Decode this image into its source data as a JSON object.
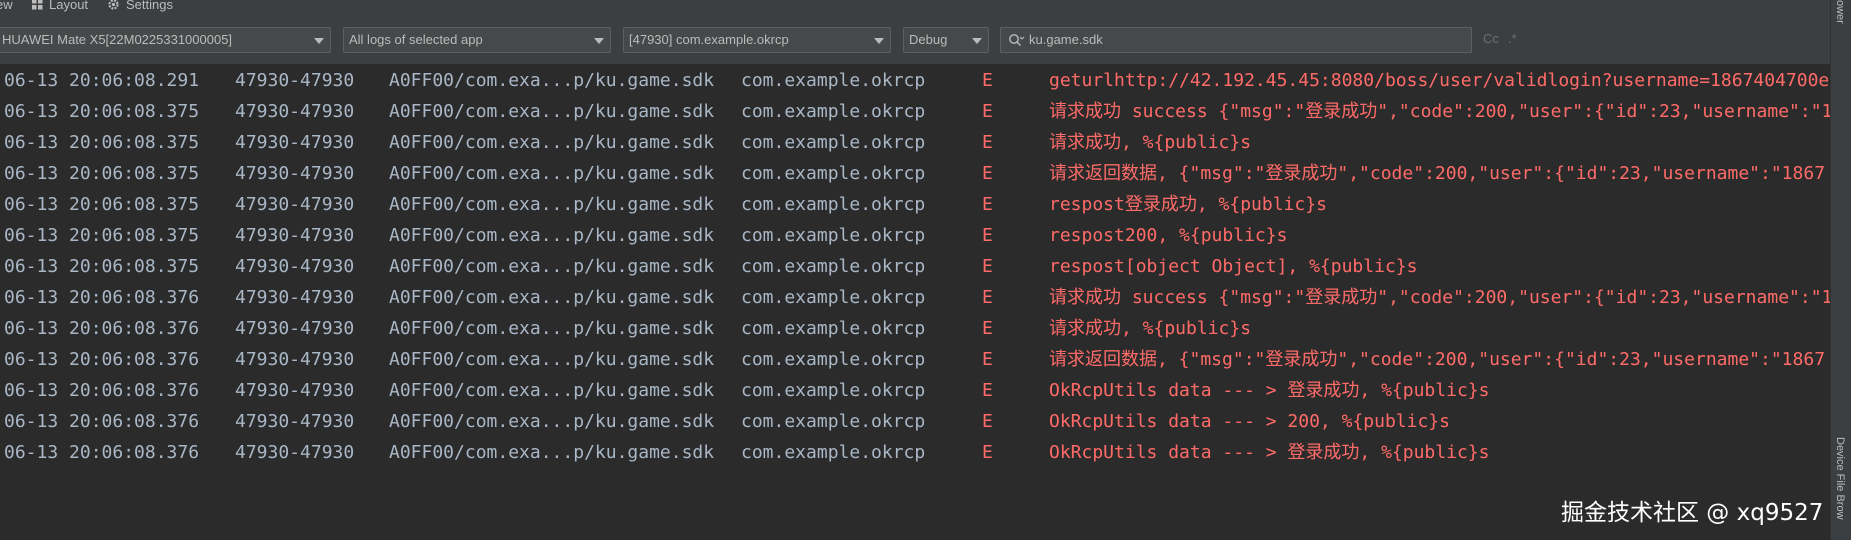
{
  "menubar": {
    "view_label": "ew",
    "layout_label": "Layout",
    "settings_label": "Settings"
  },
  "toolbar": {
    "device": "HUAWEI Mate X5[22M0225331000005]",
    "log_scope": "All logs of selected app",
    "process": "[47930] com.example.okrcp",
    "level": "Debug",
    "search_value": "ku.game.sdk",
    "match_case_label": "Cc",
    "regex_label": ".*"
  },
  "right_panel": {
    "top_label": "ower",
    "bottom_label": "Device File Brow"
  },
  "log_rows": [
    {
      "time": "06-13 20:06:08.291",
      "pid": "47930-47930",
      "tag": "A0FF00/com.exa...p/ku.game.sdk",
      "package": "com.example.okrcp",
      "level": "E",
      "message": "geturlhttp://42.192.45.45:8080/boss/user/validlogin?username=1867404700e"
    },
    {
      "time": "06-13 20:06:08.375",
      "pid": "47930-47930",
      "tag": "A0FF00/com.exa...p/ku.game.sdk",
      "package": "com.example.okrcp",
      "level": "E",
      "message": "请求成功 success {\"msg\":\"登录成功\",\"code\":200,\"user\":{\"id\":23,\"username\":\"1"
    },
    {
      "time": "06-13 20:06:08.375",
      "pid": "47930-47930",
      "tag": "A0FF00/com.exa...p/ku.game.sdk",
      "package": "com.example.okrcp",
      "level": "E",
      "message": "请求成功, %{public}s"
    },
    {
      "time": "06-13 20:06:08.375",
      "pid": "47930-47930",
      "tag": "A0FF00/com.exa...p/ku.game.sdk",
      "package": "com.example.okrcp",
      "level": "E",
      "message": "请求返回数据, {\"msg\":\"登录成功\",\"code\":200,\"user\":{\"id\":23,\"username\":\"1867"
    },
    {
      "time": "06-13 20:06:08.375",
      "pid": "47930-47930",
      "tag": "A0FF00/com.exa...p/ku.game.sdk",
      "package": "com.example.okrcp",
      "level": "E",
      "message": "respost登录成功, %{public}s"
    },
    {
      "time": "06-13 20:06:08.375",
      "pid": "47930-47930",
      "tag": "A0FF00/com.exa...p/ku.game.sdk",
      "package": "com.example.okrcp",
      "level": "E",
      "message": "respost200, %{public}s"
    },
    {
      "time": "06-13 20:06:08.375",
      "pid": "47930-47930",
      "tag": "A0FF00/com.exa...p/ku.game.sdk",
      "package": "com.example.okrcp",
      "level": "E",
      "message": "respost[object Object], %{public}s"
    },
    {
      "time": "06-13 20:06:08.376",
      "pid": "47930-47930",
      "tag": "A0FF00/com.exa...p/ku.game.sdk",
      "package": "com.example.okrcp",
      "level": "E",
      "message": "请求成功 success {\"msg\":\"登录成功\",\"code\":200,\"user\":{\"id\":23,\"username\":\"1"
    },
    {
      "time": "06-13 20:06:08.376",
      "pid": "47930-47930",
      "tag": "A0FF00/com.exa...p/ku.game.sdk",
      "package": "com.example.okrcp",
      "level": "E",
      "message": "请求成功, %{public}s"
    },
    {
      "time": "06-13 20:06:08.376",
      "pid": "47930-47930",
      "tag": "A0FF00/com.exa...p/ku.game.sdk",
      "package": "com.example.okrcp",
      "level": "E",
      "message": "请求返回数据, {\"msg\":\"登录成功\",\"code\":200,\"user\":{\"id\":23,\"username\":\"1867"
    },
    {
      "time": "06-13 20:06:08.376",
      "pid": "47930-47930",
      "tag": "A0FF00/com.exa...p/ku.game.sdk",
      "package": "com.example.okrcp",
      "level": "E",
      "message": "OkRcpUtils data --- > 登录成功, %{public}s"
    },
    {
      "time": "06-13 20:06:08.376",
      "pid": "47930-47930",
      "tag": "A0FF00/com.exa...p/ku.game.sdk",
      "package": "com.example.okrcp",
      "level": "E",
      "message": "OkRcpUtils data --- > 200, %{public}s"
    },
    {
      "time": "06-13 20:06:08.376",
      "pid": "47930-47930",
      "tag": "A0FF00/com.exa...p/ku.game.sdk",
      "package": "com.example.okrcp",
      "level": "E",
      "message": "OkRcpUtils data --- > 登录成功, %{public}s"
    }
  ],
  "watermark": "掘金技术社区 @ xq9527",
  "colors": {
    "background": "#2b2b2b",
    "toolbar": "#3c3f41",
    "log_text": "#a9b7c6",
    "error_text": "#ff6b68"
  },
  "icons": {
    "layout": "layout-grid-icon",
    "settings": "gear-icon",
    "search": "search-icon",
    "dropdown": "chevron-down-icon"
  }
}
